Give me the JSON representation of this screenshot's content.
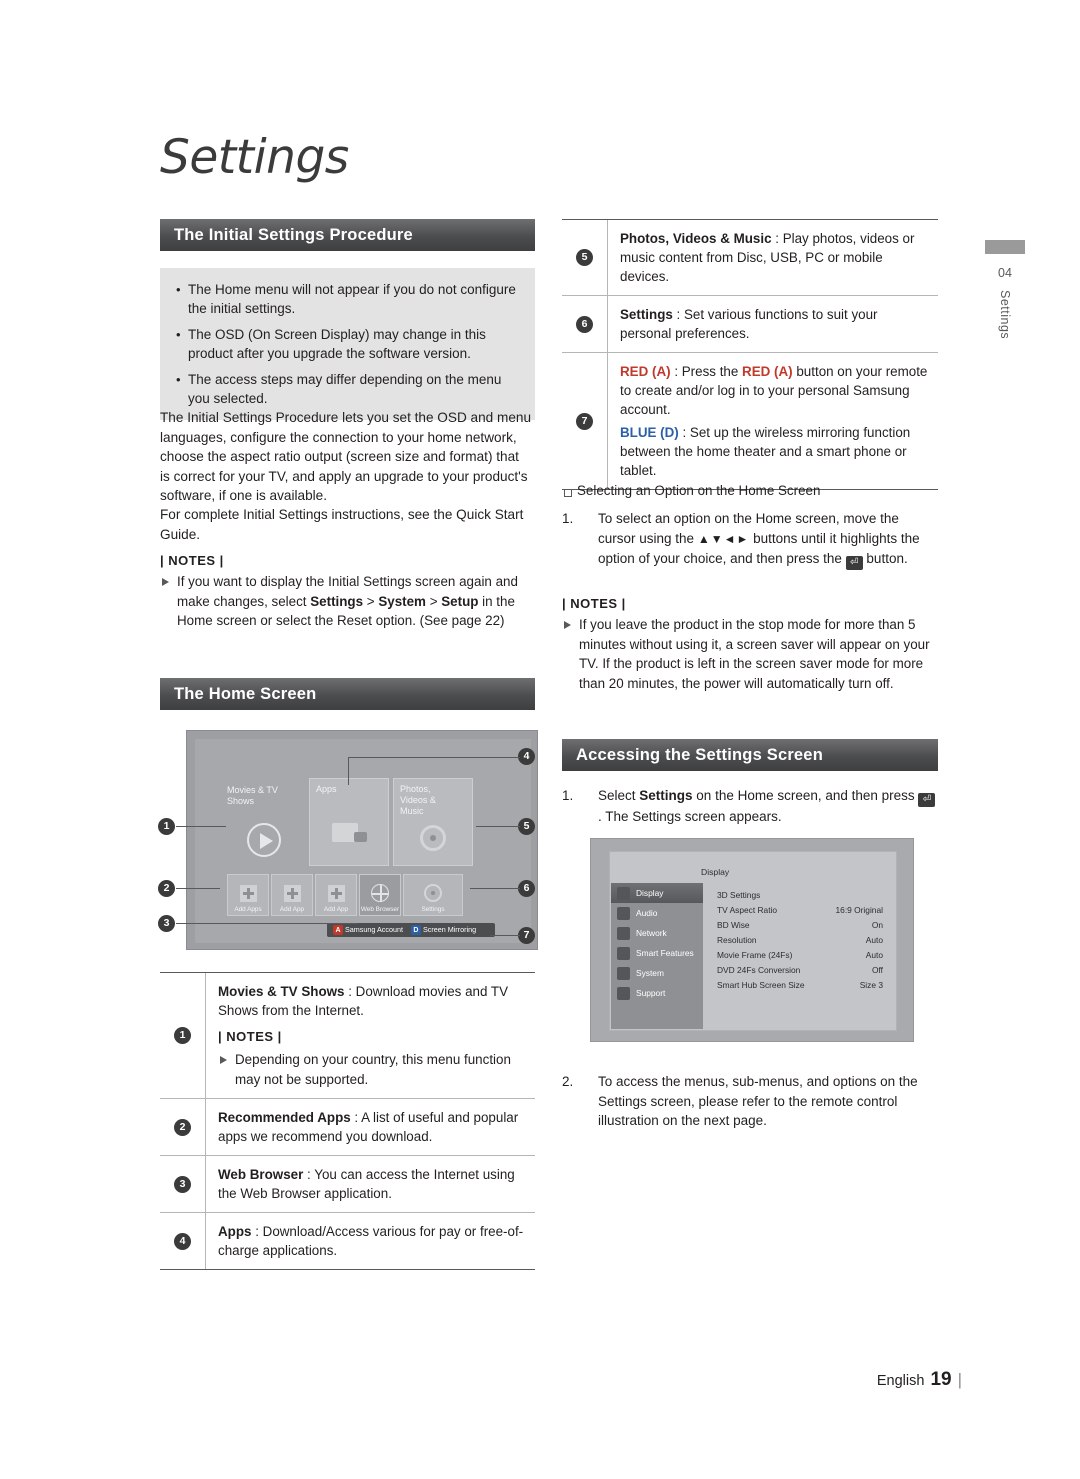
{
  "page": {
    "title": "Settings",
    "chapter_number": "04",
    "chapter_label": "Settings",
    "footer_language": "English",
    "footer_page": "19"
  },
  "left_column": {
    "section1_header": "The Initial Settings Procedure",
    "grey_bullets": [
      "The Home menu will not appear if you do not configure the initial settings.",
      "The OSD (On Screen Display) may change in this product after you upgrade the software version.",
      "The access steps may differ depending on the menu you selected."
    ],
    "paragraph1": "The Initial Settings Procedure lets you set the OSD and menu languages, configure the connection to your home network, choose the aspect ratio output (screen size and format) that is correct for your TV, and apply an upgrade to your product's software, if one is available.",
    "paragraph2": "For complete Initial Settings instructions, see the Quick Start Guide.",
    "notes_label": "| NOTES |",
    "note1_part1": "If you want to display the Initial Settings screen again and make changes, select ",
    "note1_b1": "Settings",
    "note1_part2": " > ",
    "note1_b2": "System",
    "note1_part3": " > ",
    "note1_b3": "Setup",
    "note1_part4": " in the Home screen or select the Reset option. (See page 22)",
    "section2_header": "The Home Screen",
    "desc_rows": [
      {
        "num": "1",
        "title": "Movies & TV Shows",
        "text": " : Download movies and TV Shows from the Internet.",
        "notes_label": "| NOTES |",
        "note": "Depending on your country, this menu function may not be supported."
      },
      {
        "num": "2",
        "title": "Recommended Apps",
        "text": " : A list of useful and popular apps we recommend you download."
      },
      {
        "num": "3",
        "title": "Web Browser",
        "text": " : You can access the Internet using the Web Browser application."
      },
      {
        "num": "4",
        "title": "Apps",
        "text": " : Download/Access various for pay or free-of-charge applications."
      }
    ]
  },
  "home_mock": {
    "tile_movies": "Movies & TV Shows",
    "tile_apps": "Apps",
    "tile_photos": "Photos, Videos & Music",
    "small_tiles": [
      "Add Apps",
      "Add App",
      "Add App",
      "Web Browser",
      "Settings"
    ],
    "bottom_bar": [
      {
        "key": "A",
        "key_color": "#c0392b",
        "label": "Samsung Account"
      },
      {
        "key": "D",
        "key_color": "#2b5fa8",
        "label": "Screen Mirroring"
      }
    ],
    "callouts": [
      "1",
      "2",
      "3",
      "4",
      "5",
      "6",
      "7"
    ]
  },
  "right_column": {
    "desc_rows": [
      {
        "num": "5",
        "title": "Photos, Videos & Music",
        "text": " : Play photos, videos or music content from Disc, USB, PC or mobile devices."
      },
      {
        "num": "6",
        "title": "Settings",
        "text": " : Set various functions to suit your personal preferences."
      },
      {
        "num": "7",
        "title_red": "RED (A)",
        "text_a_1": " : Press the ",
        "text_a_red": "RED (A)",
        "text_a_2": " button on your remote to create and/or log in to your personal Samsung account.",
        "title_blue": "BLUE (D)",
        "text_b": " : Set up the wireless mirroring function between the home theater and a smart phone or tablet."
      }
    ],
    "square_heading": "Selecting an Option on the Home Screen",
    "step1_num": "1.",
    "step1_part1": "To select an option on the Home screen, move the cursor using the ",
    "step1_arrows": "▲▼◄►",
    "step1_part2": " buttons until it highlights the option of your choice, and then press the ",
    "step1_part3": " button.",
    "notes_label": "| NOTES |",
    "note1": "If you leave the product in the stop mode for more than 5 minutes without using it, a screen saver will appear on your TV. If the product is left in the screen saver mode for more than 20 minutes, the power will automatically turn off.",
    "section3_header": "Accessing the Settings Screen",
    "access_step1_num": "1.",
    "access_step1_part1": "Select ",
    "access_step1_bold": "Settings",
    "access_step1_part2": " on the Home screen, and then press ",
    "access_step1_part3": ". The Settings screen appears.",
    "access_step2_num": "2.",
    "access_step2_text": "To access the menus, sub-menus, and options on the Settings screen, please refer to the remote control illustration on the next page."
  },
  "settings_mock": {
    "panel_title": "Display",
    "left_items": [
      {
        "label": "Display",
        "selected": true
      },
      {
        "label": "Audio",
        "selected": false
      },
      {
        "label": "Network",
        "selected": false
      },
      {
        "label": "Smart Features",
        "selected": false
      },
      {
        "label": "System",
        "selected": false
      },
      {
        "label": "Support",
        "selected": false
      }
    ],
    "rows": [
      {
        "label": "3D Settings",
        "value": ""
      },
      {
        "label": "TV Aspect Ratio",
        "value": "16:9 Original"
      },
      {
        "label": "BD Wise",
        "value": "On"
      },
      {
        "label": "Resolution",
        "value": "Auto"
      },
      {
        "label": "Movie Frame (24Fs)",
        "value": "Auto"
      },
      {
        "label": "DVD 24Fs Conversion",
        "value": "Off"
      },
      {
        "label": "Smart Hub Screen Size",
        "value": "Size 3"
      }
    ]
  }
}
